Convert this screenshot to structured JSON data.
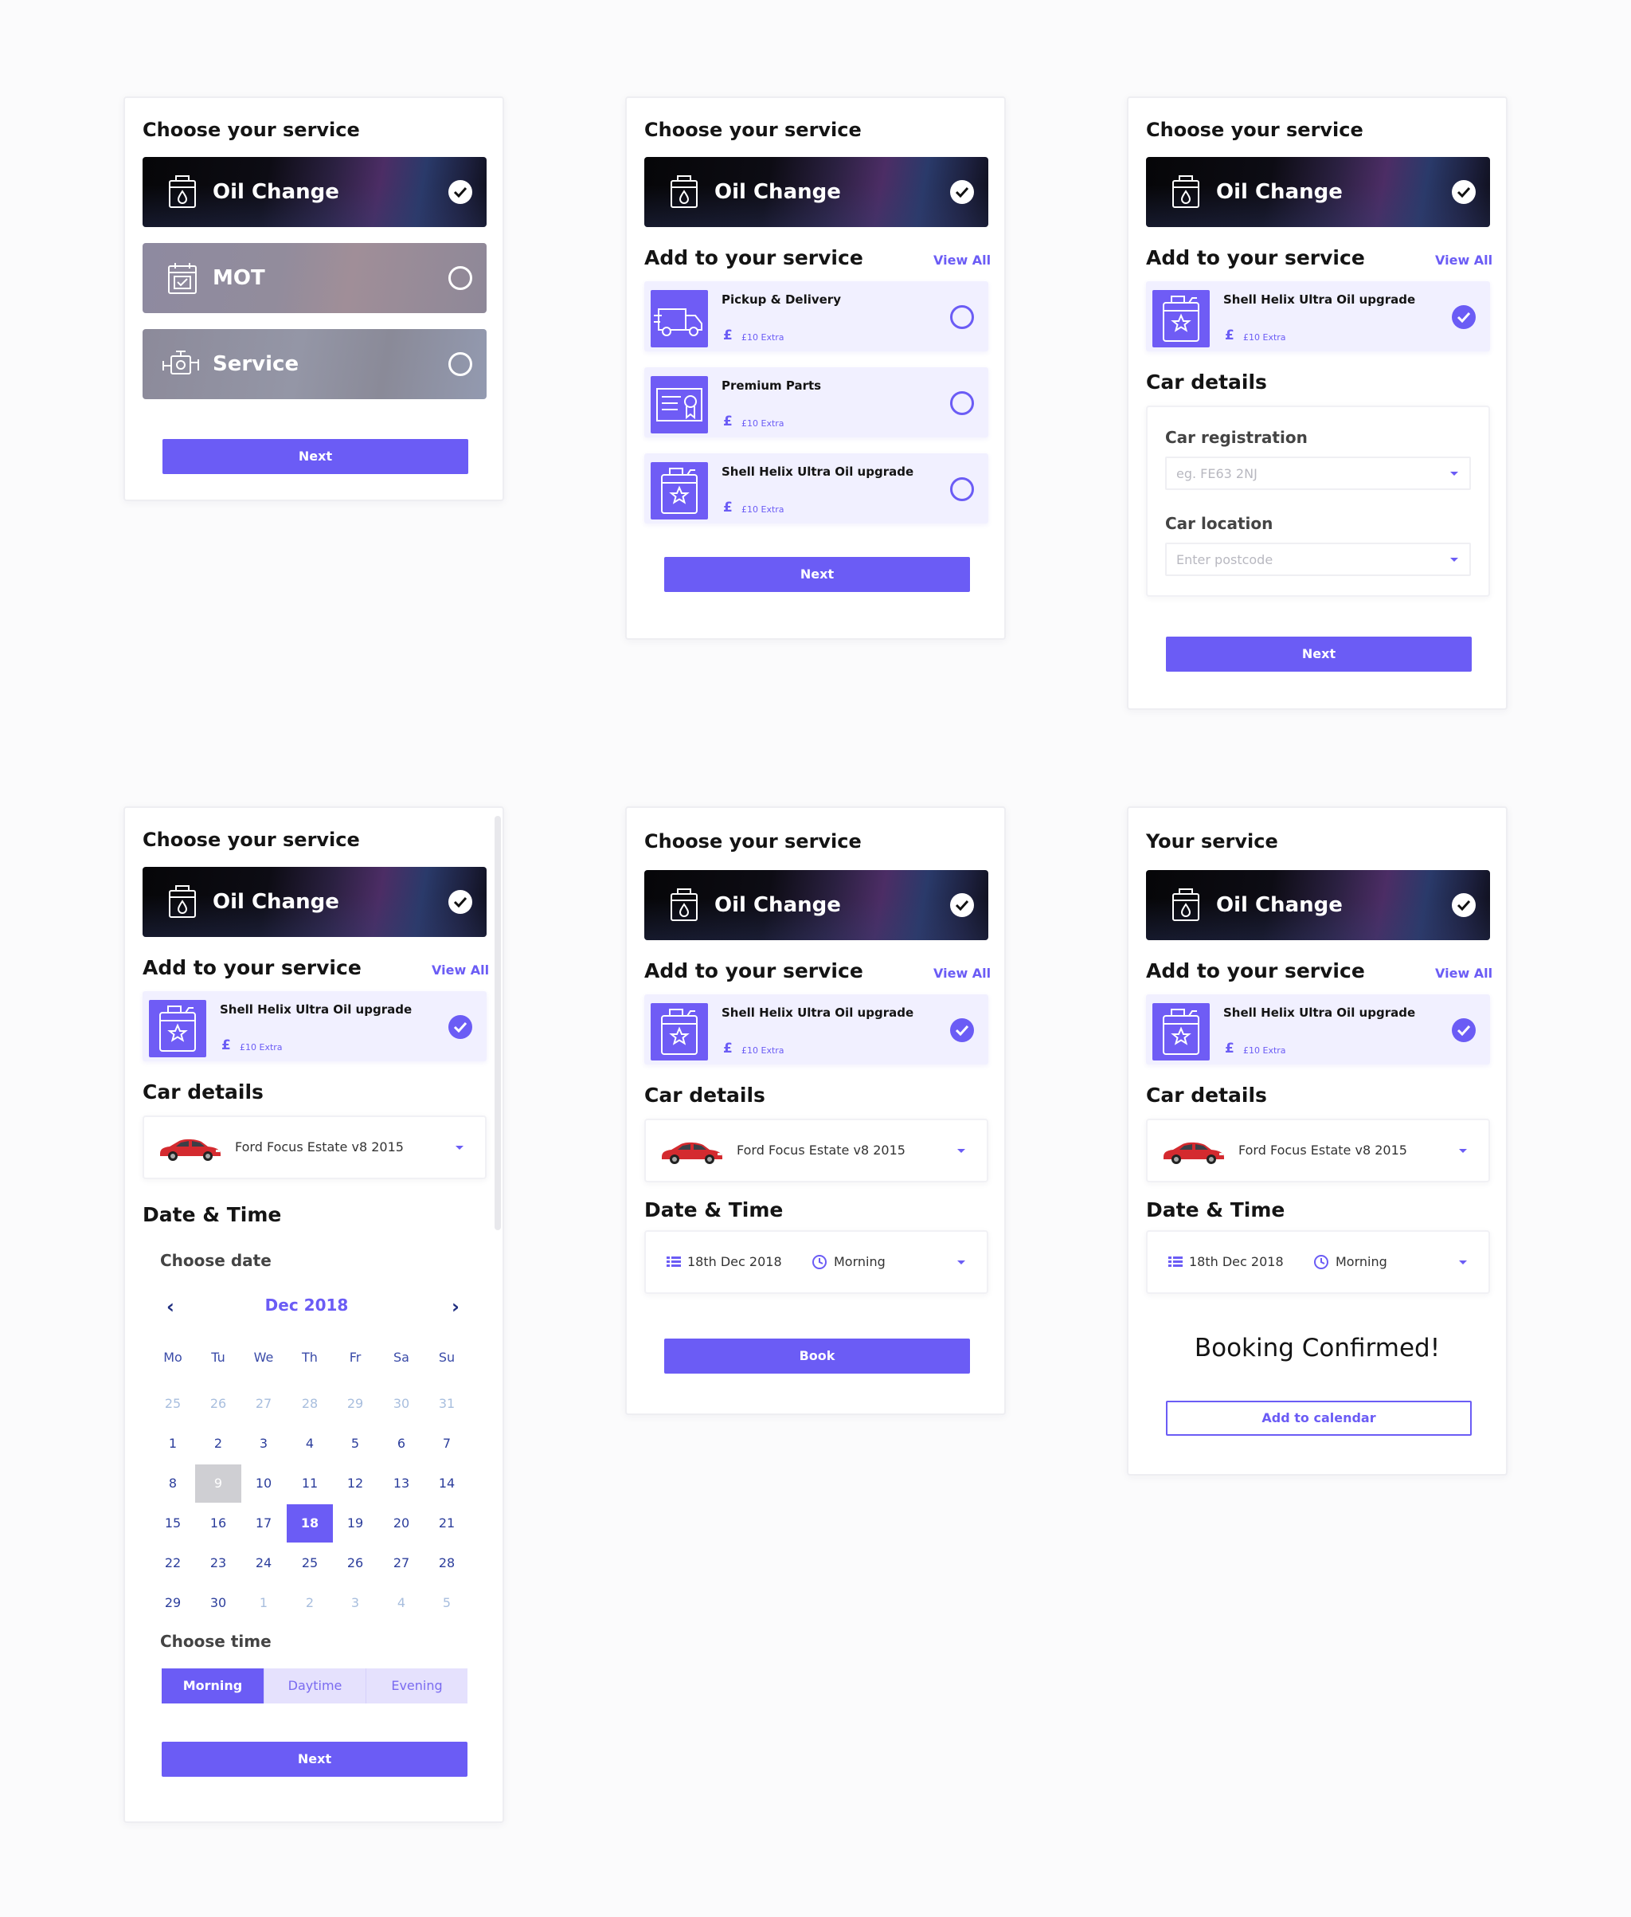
{
  "colors": {
    "accent": "#6b5cf5",
    "accent_light": "#f1f0ff",
    "text": "#141414",
    "muted_day": "#a8bede",
    "disabled_day": "#cfcfd3"
  },
  "common": {
    "choose_service": "Choose your service",
    "your_service": "Your service",
    "add_to_service": "Add to your service",
    "view_all": "View All",
    "car_details": "Car details",
    "date_time": "Date & Time",
    "pound": "£",
    "next": "Next",
    "book": "Book"
  },
  "services": [
    {
      "label": "Oil Change",
      "icon": "oil-can-icon",
      "selected": true
    },
    {
      "label": "MOT",
      "icon": "calendar-check-icon",
      "selected": false
    },
    {
      "label": "Service",
      "icon": "engine-icon",
      "selected": false
    }
  ],
  "addons": [
    {
      "name": "Pickup & Delivery",
      "price": "£10 Extra",
      "icon": "truck-icon"
    },
    {
      "name": "Premium Parts",
      "price": "£10 Extra",
      "icon": "certificate-icon"
    },
    {
      "name": "Shell Helix Ultra Oil upgrade",
      "price": "£10 Extra",
      "icon": "oil-canister-icon"
    }
  ],
  "car_form": {
    "registration_label": "Car registration",
    "registration_placeholder": "eg. FE63 2NJ",
    "location_label": "Car location",
    "location_placeholder": "Enter postcode"
  },
  "car": {
    "name": "Ford Focus Estate v8 2015",
    "image": "red-car-image"
  },
  "calendar": {
    "choose_date": "Choose date",
    "month": "Dec 2018",
    "weekdays": [
      "Mo",
      "Tu",
      "We",
      "Th",
      "Fr",
      "Sa",
      "Su"
    ],
    "weeks": [
      [
        "25",
        "26",
        "27",
        "28",
        "29",
        "30",
        "31"
      ],
      [
        "1",
        "2",
        "3",
        "4",
        "5",
        "6",
        "7"
      ],
      [
        "8",
        "9",
        "10",
        "11",
        "12",
        "13",
        "14"
      ],
      [
        "15",
        "16",
        "17",
        "18",
        "19",
        "20",
        "21"
      ],
      [
        "22",
        "23",
        "24",
        "25",
        "26",
        "27",
        "28"
      ],
      [
        "29",
        "30",
        "1",
        "2",
        "3",
        "4",
        "5"
      ]
    ],
    "disabled_day": "9",
    "selected_day": "18",
    "choose_time": "Choose time",
    "time_options": [
      "Morning",
      "Daytime",
      "Evening"
    ],
    "selected_time": "Morning"
  },
  "booking": {
    "date": "18th Dec 2018",
    "time": "Morning",
    "confirmed": "Booking Confirmed!",
    "add_to_calendar": "Add to calendar"
  }
}
